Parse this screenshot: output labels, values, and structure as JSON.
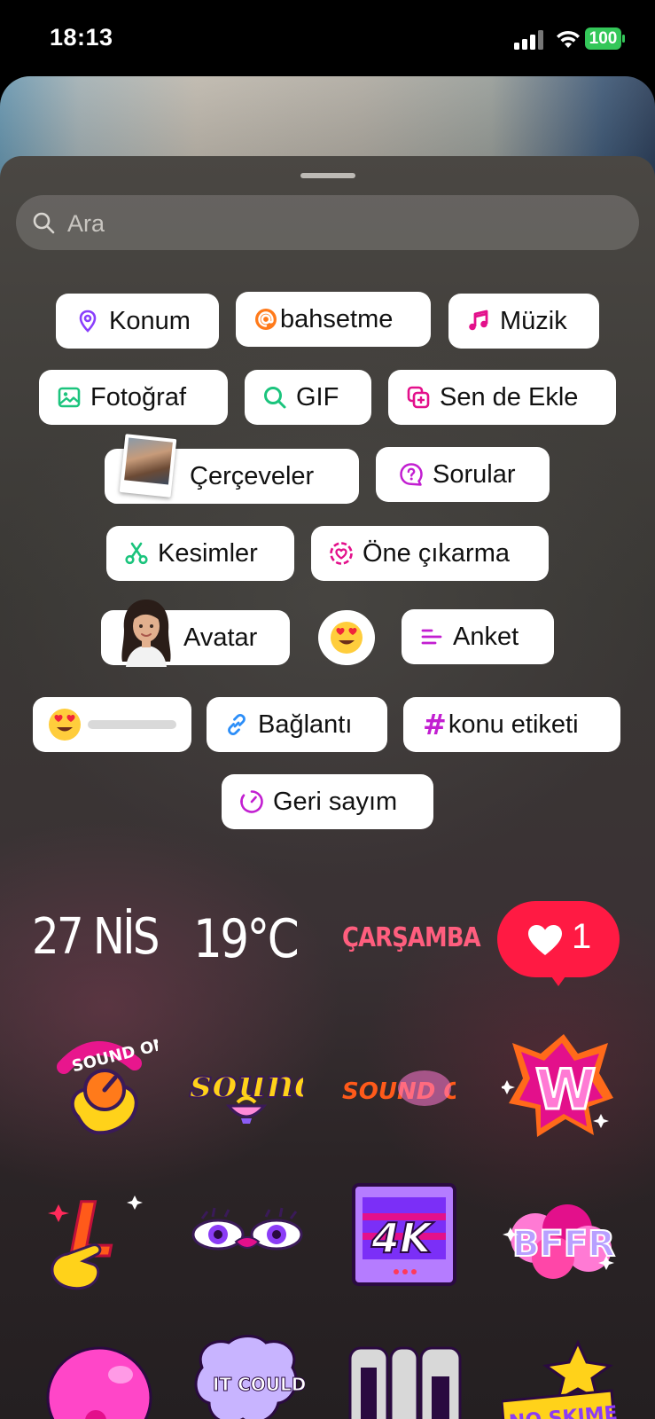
{
  "status_bar": {
    "time": "18:13",
    "battery": "100"
  },
  "search": {
    "placeholder": "Ara"
  },
  "chips": {
    "konum": "Konum",
    "bahsetme": "bahsetme",
    "muzik": "Müzik",
    "fotograf": "Fotoğraf",
    "gif": "GIF",
    "sen_de_ekle": "Sen de Ekle",
    "cerceveler": "Çerçeveler",
    "sorular": "Sorular",
    "kesimler": "Kesimler",
    "one_cikarma": "Öne çıkarma",
    "avatar": "Avatar",
    "anket": "Anket",
    "baglanti": "Bağlantı",
    "konu_etiketi": "konu etiketi",
    "geri_sayim": "Geri sayım"
  },
  "info_stickers": {
    "date": "27 NİS",
    "temperature": "19°C",
    "weekday": "ÇARŞAMBA",
    "likes": "1"
  },
  "stickers": [
    {
      "text": "SOUND ON"
    },
    {
      "text": "sound"
    },
    {
      "text": "SOUND ON!"
    },
    {
      "text": "W"
    },
    {
      "text": "L"
    },
    {
      "text": ""
    },
    {
      "text": "4K"
    },
    {
      "text": "BFFR"
    },
    {
      "text": ""
    },
    {
      "text": "IT COULD BE"
    },
    {
      "text": ""
    },
    {
      "text": "NO SKIMES"
    }
  ],
  "colors": {
    "chip_bg": "#ffffff",
    "accent_purple": "#8a3ffc",
    "accent_orange": "#ff6b1a",
    "accent_pink": "#e3108b",
    "accent_green": "#1bc47d",
    "accent_blue": "#2c8ef8",
    "heart_red": "#ff1a43"
  }
}
